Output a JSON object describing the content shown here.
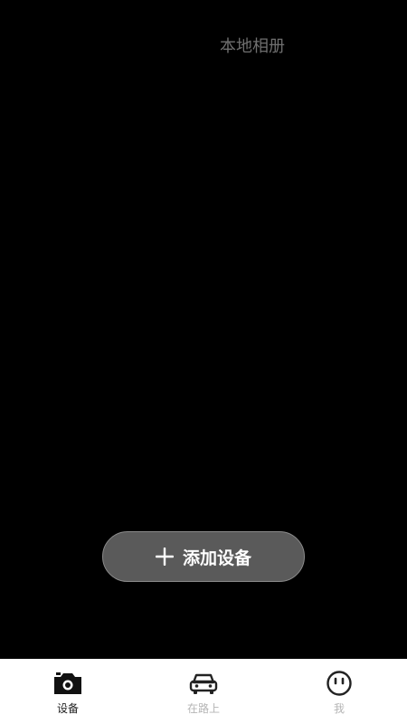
{
  "header": {
    "local_album_label": "本地相册"
  },
  "main": {
    "add_device_label": "添加设备",
    "add_device_icon": "plus-icon"
  },
  "tab_bar": {
    "items": [
      {
        "label": "设备",
        "icon": "camera-icon",
        "active": true
      },
      {
        "label": "在路上",
        "icon": "car-icon",
        "active": false
      },
      {
        "label": "我",
        "icon": "smiley-face-icon",
        "active": false
      }
    ]
  },
  "colors": {
    "background": "#000000",
    "button_fill": "#5a5a5a",
    "button_border": "#8a8a8a",
    "tab_active": "#222222",
    "tab_inactive": "#b5b5b5",
    "top_tab_text": "#6f6f6f"
  }
}
